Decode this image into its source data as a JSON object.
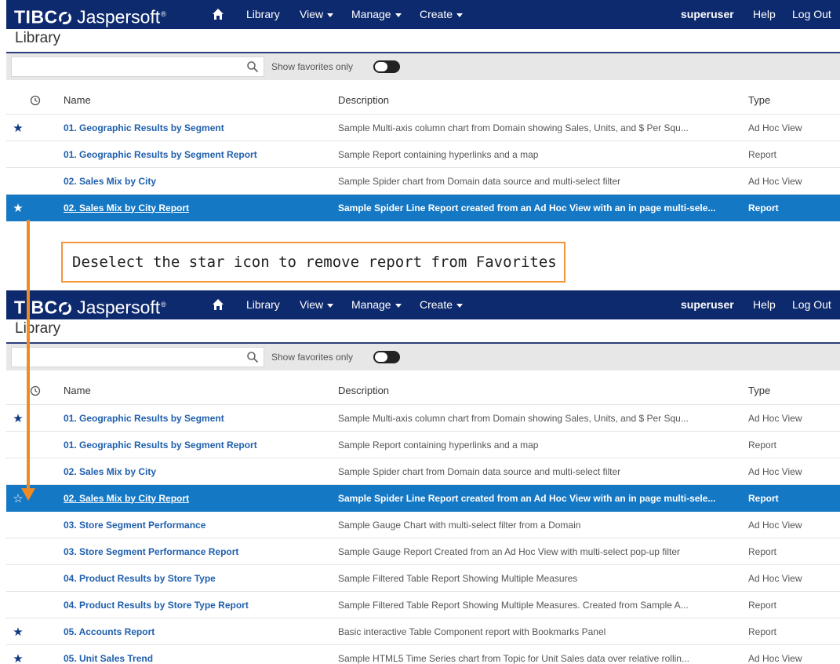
{
  "callout": {
    "text": "Deselect the star icon to remove report from Favorites"
  },
  "colors": {
    "nav": "#0e2a6e",
    "selected": "#1578c5",
    "link": "#1f5fad",
    "callout_border": "#f2963b",
    "arrow": "#f08a24"
  },
  "top": {
    "brand": {
      "tibco": "TIBC",
      "jaspersoft": "Jaspersoft",
      "reg": "®"
    },
    "nav": {
      "library": "Library",
      "view": "View",
      "manage": "Manage",
      "create": "Create",
      "user": "superuser",
      "help": "Help",
      "logout": "Log Out"
    },
    "page_title": "Library",
    "toolbar": {
      "search_placeholder": "",
      "favorites_label": "Show favorites only"
    },
    "columns": {
      "name": "Name",
      "description": "Description",
      "type": "Type"
    },
    "rows": [
      {
        "star": "★",
        "name": "01. Geographic Results by Segment",
        "description": "Sample Multi-axis column chart from Domain showing Sales, Units, and $ Per Squ...",
        "type": "Ad Hoc View"
      },
      {
        "star": "",
        "name": "01. Geographic Results by Segment Report",
        "description": "Sample Report containing hyperlinks and a map",
        "type": "Report"
      },
      {
        "star": "",
        "name": "02. Sales Mix by City",
        "description": "Sample Spider chart from Domain data source and multi-select filter",
        "type": "Ad Hoc View"
      },
      {
        "star": "★",
        "name": "02. Sales Mix by City Report",
        "description": "Sample Spider Line Report created from an Ad Hoc View with an in page multi-sele...",
        "type": "Report"
      }
    ]
  },
  "bottom": {
    "brand": {
      "tibco": "TIBC",
      "jaspersoft": "Jaspersoft",
      "reg": "®"
    },
    "nav": {
      "library": "Library",
      "view": "View",
      "manage": "Manage",
      "create": "Create",
      "user": "superuser",
      "help": "Help",
      "logout": "Log Out"
    },
    "page_title": "Library",
    "toolbar": {
      "search_placeholder": "",
      "favorites_label": "Show favorites only"
    },
    "columns": {
      "name": "Name",
      "description": "Description",
      "type": "Type"
    },
    "rows": [
      {
        "star": "★",
        "name": "01. Geographic Results by Segment",
        "description": "Sample Multi-axis column chart from Domain showing Sales, Units, and $ Per Squ...",
        "type": "Ad Hoc View"
      },
      {
        "star": "",
        "name": "01. Geographic Results by Segment Report",
        "description": "Sample Report containing hyperlinks and a map",
        "type": "Report"
      },
      {
        "star": "",
        "name": "02. Sales Mix by City",
        "description": "Sample Spider chart from Domain data source and multi-select filter",
        "type": "Ad Hoc View"
      },
      {
        "star": "☆",
        "name": "02. Sales Mix by City Report",
        "description": "Sample Spider Line Report created from an Ad Hoc View with an in page multi-sele...",
        "type": "Report"
      },
      {
        "star": "",
        "name": "03. Store Segment Performance",
        "description": "Sample Gauge Chart with multi-select filter from a Domain",
        "type": "Ad Hoc View"
      },
      {
        "star": "",
        "name": "03. Store Segment Performance Report",
        "description": "Sample Gauge Report Created from an Ad Hoc View with multi-select pop-up filter",
        "type": "Report"
      },
      {
        "star": "",
        "name": "04. Product Results by Store Type",
        "description": "Sample Filtered Table Report Showing Multiple Measures",
        "type": "Ad Hoc View"
      },
      {
        "star": "",
        "name": "04. Product Results by Store Type Report",
        "description": "Sample Filtered Table Report Showing Multiple Measures. Created from Sample A...",
        "type": "Report"
      },
      {
        "star": "★",
        "name": "05. Accounts Report",
        "description": "Basic interactive Table Component report with Bookmarks Panel",
        "type": "Report"
      },
      {
        "star": "★",
        "name": "05. Unit Sales Trend",
        "description": "Sample HTML5 Time Series chart from Topic for Unit Sales data over relative rollin...",
        "type": "Ad Hoc View"
      }
    ]
  }
}
